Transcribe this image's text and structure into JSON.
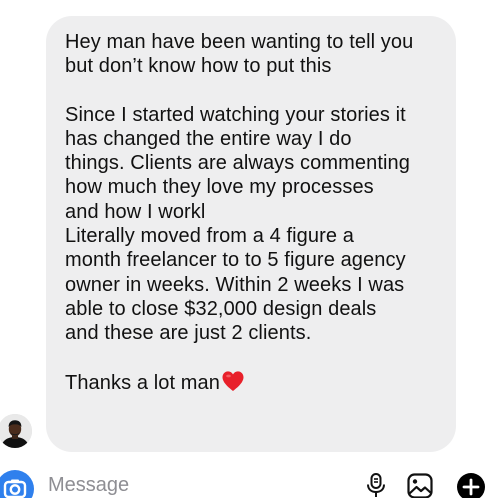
{
  "message": {
    "paragraph_1": "Hey man have been wanting to tell you\nbut don’t know how to put this",
    "paragraph_2": "Since I started watching your stories it\nhas changed the entire way I do\nthings. Clients are always commenting\nhow much they love my processes\nand how I workl",
    "paragraph_3": "Literally moved from a 4 figure a\nmonth freelancer to to 5 figure agency\nowner in weeks.  Within 2 weeks I was\nable to close $32,000 design deals\nand these are just 2 clients.",
    "paragraph_4": "Thanks a lot man",
    "heart_icon": "red-heart-emoji"
  },
  "composer": {
    "placeholder": "Message",
    "icons": [
      "camera-icon",
      "microphone-icon",
      "gallery-icon",
      "plus-icon"
    ]
  },
  "colors": {
    "bubble_bg": "#eeeeef",
    "text": "#111111",
    "camera_blue": "#2f80ed",
    "heart_red": "#e8202a"
  }
}
